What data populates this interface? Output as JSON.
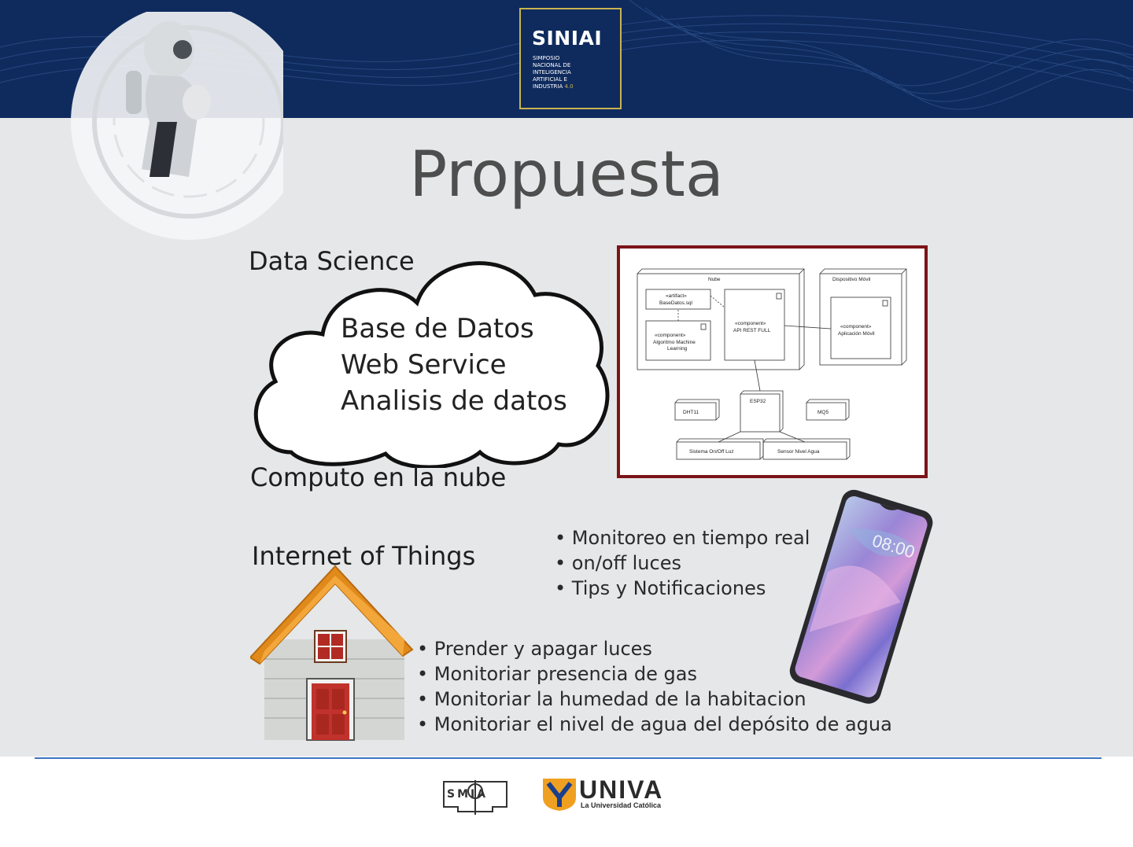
{
  "header": {
    "logo": {
      "title": "SINIAI",
      "lines": [
        "SIMPOSIO",
        "NACIONAL DE",
        "INTELIGENCIA",
        "ARTIFICIAL E"
      ],
      "last_line": "INDUSTRIA",
      "last_line_version": "4.0"
    }
  },
  "slide": {
    "title": "Propuesta"
  },
  "cloud": {
    "top_label": "Data Science",
    "items": [
      "Base de Datos",
      "Web Service",
      "Analisis de datos"
    ],
    "bottom_label": "Computo en la nube"
  },
  "diagram": {
    "cloud_node": "Nube",
    "artifact_stereotype": "«artifact»",
    "artifact_name": "BaseDatos.sql",
    "component_stereotype": "«component»",
    "ml_name_line1": "Algoritmo Machine",
    "ml_name_line2": "Learning",
    "api_name": "API REST FULL",
    "mobile_node": "Dispositivo Móvil",
    "app_name": "Aplicación Móvil",
    "esp": "ESP32",
    "dht": "DHT11",
    "mq": "MQ5",
    "light": "Sistema On/Off Luz",
    "water": "Sensor Nivel Agua"
  },
  "iot": {
    "label": "Internet of Things",
    "house_items": [
      "Prender y apagar luces",
      "Monitoriar presencia de gas",
      "Monitoriar la humedad de la habitacion",
      "Monitoriar el nivel de agua del depósito de agua"
    ]
  },
  "phone": {
    "time": "08:00",
    "items": [
      "Monitoreo en tiempo real",
      "on/off luces",
      "Tips y Notificaciones"
    ]
  },
  "footer": {
    "smia_text": "SMIA",
    "univa_name": "UNIVA",
    "univa_tagline": "La Universidad Católica"
  },
  "colors": {
    "header_bg": "#0f2b5e",
    "logo_border": "#c9b450",
    "content_bg": "#e5e7e8",
    "diagram_border": "#7b1418",
    "footer_line": "#3a75c4",
    "univa_orange": "#f0a020"
  }
}
